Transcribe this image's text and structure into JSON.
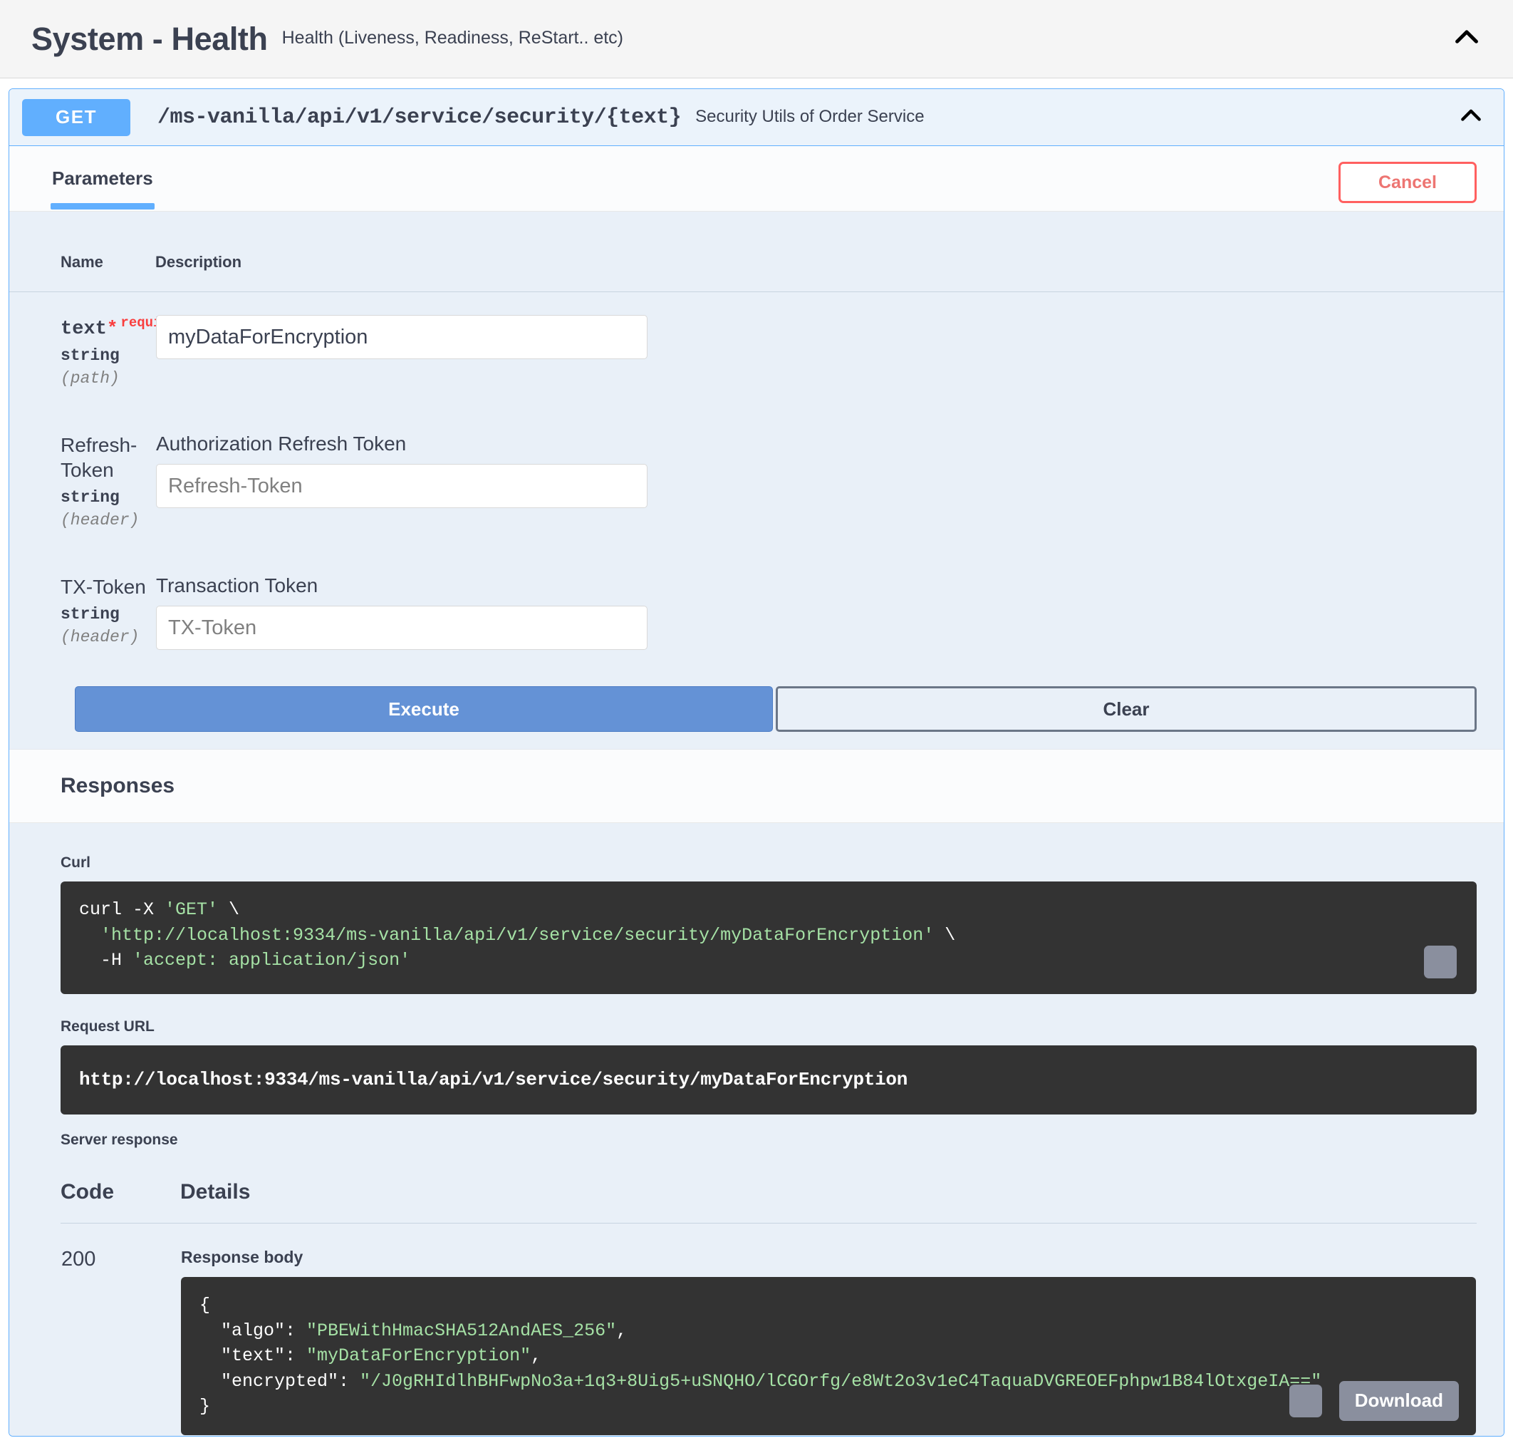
{
  "tag": {
    "title": "System - Health",
    "description": "Health (Liveness, Readiness, ReStart.. etc)",
    "collapse_icon": "chevron-up-icon"
  },
  "operation": {
    "method": "GET",
    "path": "/ms-vanilla/api/v1/service/security/{text}",
    "summary": "Security Utils of Order Service",
    "collapse_icon": "chevron-up-icon",
    "accent_color": "#61affe"
  },
  "tabs": [
    {
      "label": "Parameters",
      "active": true
    }
  ],
  "cancel_button": {
    "label": "Cancel",
    "color": "#ed7572",
    "border_color": "#ff6060"
  },
  "parameters_table": {
    "headers": {
      "name": "Name",
      "description": "Description"
    },
    "rows": [
      {
        "name": "text",
        "required_star": "*",
        "required_label": "required",
        "type": "string",
        "in": "(path)",
        "description": "",
        "value": "myDataForEncryption",
        "placeholder": ""
      },
      {
        "name": "Refresh-Token",
        "required_star": "",
        "required_label": "",
        "type": "string",
        "in": "(header)",
        "description": "Authorization Refresh Token",
        "value": "",
        "placeholder": "Refresh-Token"
      },
      {
        "name": "TX-Token",
        "required_star": "",
        "required_label": "",
        "type": "string",
        "in": "(header)",
        "description": "Transaction Token",
        "value": "",
        "placeholder": "TX-Token"
      }
    ]
  },
  "actions": {
    "execute_label": "Execute",
    "clear_label": "Clear",
    "execute_color": "#6492d6"
  },
  "responses": {
    "section_title": "Responses",
    "curl_label": "Curl",
    "curl_line1_cmd": "curl -X ",
    "curl_line1_str": "'GET'",
    "curl_line1_tail": " \\",
    "curl_line2_str": "'http://localhost:9334/ms-vanilla/api/v1/service/security/myDataForEncryption'",
    "curl_line2_tail": " \\",
    "curl_line3_cmd": "  -H ",
    "curl_line3_str": "'accept: application/json'",
    "curl_copy_icon": "copy-icon",
    "request_url_label": "Request URL",
    "request_url": "http://localhost:9334/ms-vanilla/api/v1/service/security/myDataForEncryption",
    "server_response_label": "Server response",
    "table_headers": {
      "code": "Code",
      "details": "Details"
    },
    "status_code": "200",
    "response_body_label": "Response body",
    "response_body": {
      "open_brace": "{",
      "line_algo_key": "  \"algo\": ",
      "line_algo_val": "\"PBEWithHmacSHA512AndAES_256\"",
      "line_algo_comma": ",",
      "line_text_key": "  \"text\": ",
      "line_text_val": "\"myDataForEncryption\"",
      "line_text_comma": ",",
      "line_enc_key": "  \"encrypted\": ",
      "line_enc_val": "\"/J0gRHIdlhBHFwpNo3a+1q3+8Uig5+uSNQHO/lCGOrfg/e8Wt2o3v1eC4TaquaDVGREOEFphpw1B84lOtxgeIA==\"",
      "close_brace": "}"
    },
    "response_copy_icon": "copy-icon",
    "download_label": "Download"
  }
}
